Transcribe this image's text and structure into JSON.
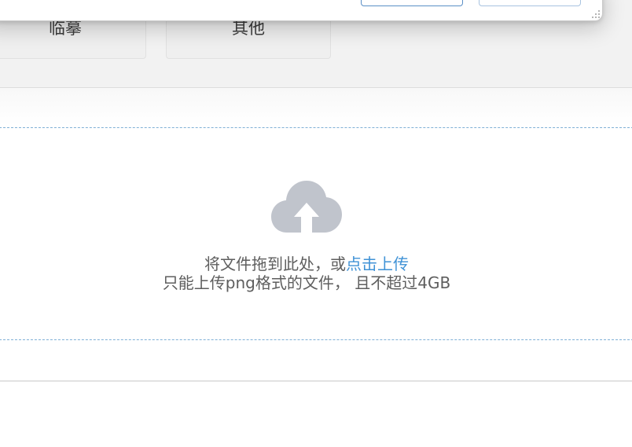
{
  "categories": {
    "items": [
      {
        "label": "临摹"
      },
      {
        "label": "其他"
      }
    ]
  },
  "dialog": {
    "buttons": [
      {
        "label": ""
      },
      {
        "label": ""
      }
    ]
  },
  "upload": {
    "icon": "cloud-upload-icon",
    "prompt": "将文件拖到此处，或",
    "click_label": "点击上传",
    "tip": "只能上传png格式的文件， 且不超过4GB"
  },
  "colors": {
    "link": "#3f92d6",
    "dropzone_border": "#7fb0d6",
    "icon": "#c0c4cc",
    "text": "#5e5e5e"
  }
}
